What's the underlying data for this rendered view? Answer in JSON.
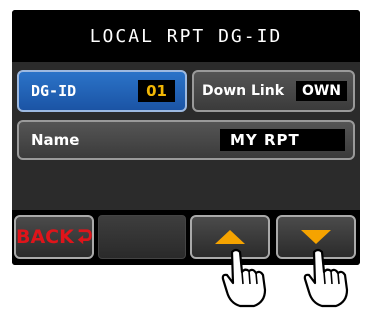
{
  "title": "LOCAL RPT DG-ID",
  "dgid": {
    "label": "DG-ID",
    "value": "01"
  },
  "downlink": {
    "label": "Down Link",
    "value": "OWN"
  },
  "name": {
    "label": "Name",
    "value": "MY RPT"
  },
  "footer": {
    "back_label": "BACK"
  },
  "colors": {
    "accent_blue": "#1b54a5",
    "value_yellow": "#f2b705",
    "back_red": "#e0141a",
    "arrow_orange": "#f5a300"
  }
}
